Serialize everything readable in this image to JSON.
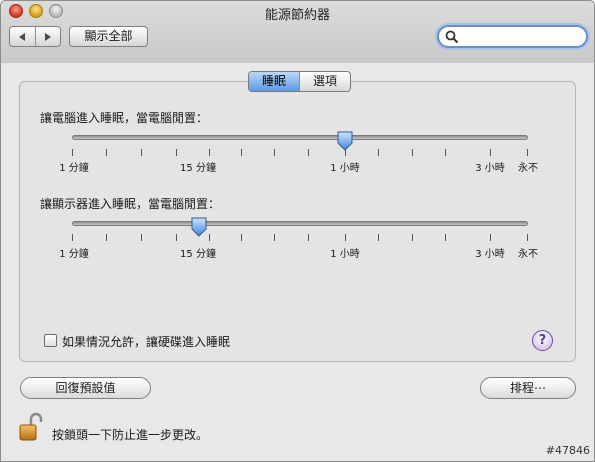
{
  "window": {
    "title": "能源節約器"
  },
  "toolbar": {
    "back_icon": "back-arrow-icon",
    "forward_icon": "forward-arrow-icon",
    "show_all_label": "顯示全部",
    "search_value": "",
    "search_placeholder": ""
  },
  "tabs": [
    {
      "label": "睡眠",
      "active": true
    },
    {
      "label": "選項",
      "active": false
    }
  ],
  "computer_sleep": {
    "label": "讓電腦進入睡眠，當電腦閒置：",
    "value": "1 小時",
    "ticks": {
      "one_min": "1 分鐘",
      "fifteen_min": "15 分鐘",
      "one_hour": "1 小時",
      "three_hours": "3 小時",
      "never": "永不"
    }
  },
  "display_sleep": {
    "label": "讓顯示器進入睡眠，當電腦閒置：",
    "value": "15 分鐘",
    "ticks": {
      "one_min": "1 分鐘",
      "fifteen_min": "15 分鐘",
      "one_hour": "1 小時",
      "three_hours": "3 小時",
      "never": "永不"
    }
  },
  "options": {
    "disk_sleep_label": "如果情況允許，讓硬碟進入睡眠",
    "disk_sleep_checked": false,
    "help_label": "?"
  },
  "buttons": {
    "restore_defaults": "回復預設值",
    "schedule": "排程⋯"
  },
  "lock": {
    "state": "unlocked",
    "message": "按鎖頭一下防止進一步更改。"
  },
  "watermark": "#47846",
  "colors": {
    "accent": "#5f9ae6",
    "search_focus": "#6d8fc6",
    "help_purple": "#5a3f94"
  }
}
